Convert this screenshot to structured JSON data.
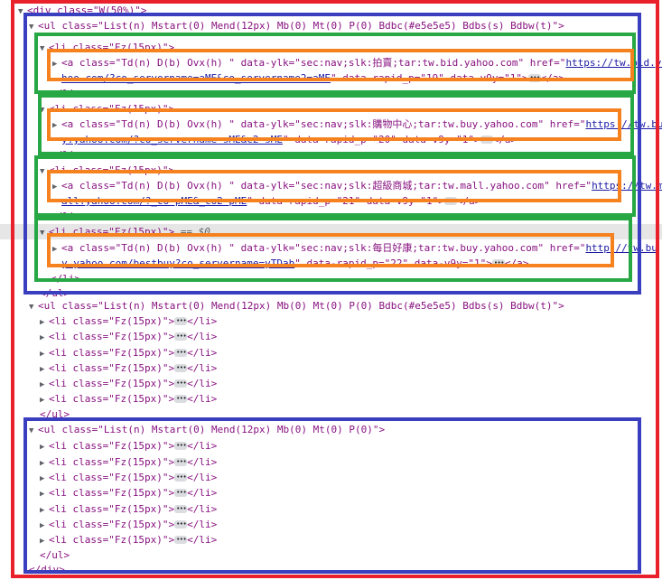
{
  "tree": {
    "div_open": "<div class=\"W(50%)\">",
    "div_close": "</div>",
    "ul1_open": "<ul class=\"List(n) Mstart(0) Mend(12px) Mb(0) Mt(0) P(0) Bdbc(#e5e5e5) Bdbs(s) Bdbw(t)\">",
    "ul2_open": "<ul class=\"List(n) Mstart(0) Mend(12px) Mb(0) Mt(0) P(0) Bdbc(#e5e5e5) Bdbs(s) Bdbw(t)\">",
    "ul3_open": "<ul class=\"List(n) Mstart(0) Mend(12px) Mb(0) Mt(0) P(0)\">",
    "ul_close": "</ul>",
    "li_open": "<li class=\"Fz(15px)\">",
    "li_close": "</li>",
    "li_collapsed_open": "<li class=\"Fz(15px)\">",
    "li_collapsed_close": "</li>",
    "selected_marker": "== $0",
    "links": [
      {
        "open": "<a class=\"Td(n) D(b) Ovx(h) \" data-ylk=\"sec:nav;slk:拍賣;tar:tw.bid.yahoo.com\" href=\"",
        "href1": "https://tw.bid.ya",
        "href2": "hoo.com/?co_servername=aME&co_servername2=aME",
        "rest": "\" data-rapid_p=\"19\" data-v9y=\"1\">",
        "close": "</a>"
      },
      {
        "open": "<a class=\"Td(n) D(b) Ovx(h) \" data-ylk=\"sec:nav;slk:購物中心;tar:tw.buy.yahoo.com\" href=\"",
        "href1": "https://tw.bu",
        "href2": "y.yahoo.com/?co_servername=sME&c2=sME",
        "rest": "\" data-rapid_p=\"20\" data-v9y=\"1\">",
        "close": "</a>"
      },
      {
        "open": "<a class=\"Td(n) D(b) Ovx(h) \" data-ylk=\"sec:nav;slk:超級商城;tar:tw.mall.yahoo.com\" href=\"",
        "href1": "https://tw.m",
        "href2": "all.yahoo.com/?_co=pME&_co2=pME",
        "rest": "\" data-rapid_p=\"21\" data-v9y=\"1\">",
        "close": "</a>"
      },
      {
        "open": "<a class=\"Td(n) D(b) Ovx(h) \" data-ylk=\"sec:nav;slk:每日好康;tar:tw.buy.yahoo.com\" href=\"",
        "href1": "http://tw.bu",
        "href2": "y.yahoo.com/bestbuy?co_servername=yTDab",
        "rest": "\" data-rapid_p=\"22\" data-v9y=\"1\">",
        "close": "</a>"
      }
    ]
  },
  "colors": {
    "red_box": "#e8212b",
    "blue_box": "#3a3fbf",
    "green_box": "#27a844",
    "orange_box": "#f5821f",
    "tag": "#881280",
    "attr_value": "#1a1aa6",
    "selected_row": "#e6e6e6"
  },
  "icons": {
    "expanded": "triangle-down-icon",
    "collapsed": "triangle-right-icon",
    "ellipsis": "ellipsis-icon"
  }
}
